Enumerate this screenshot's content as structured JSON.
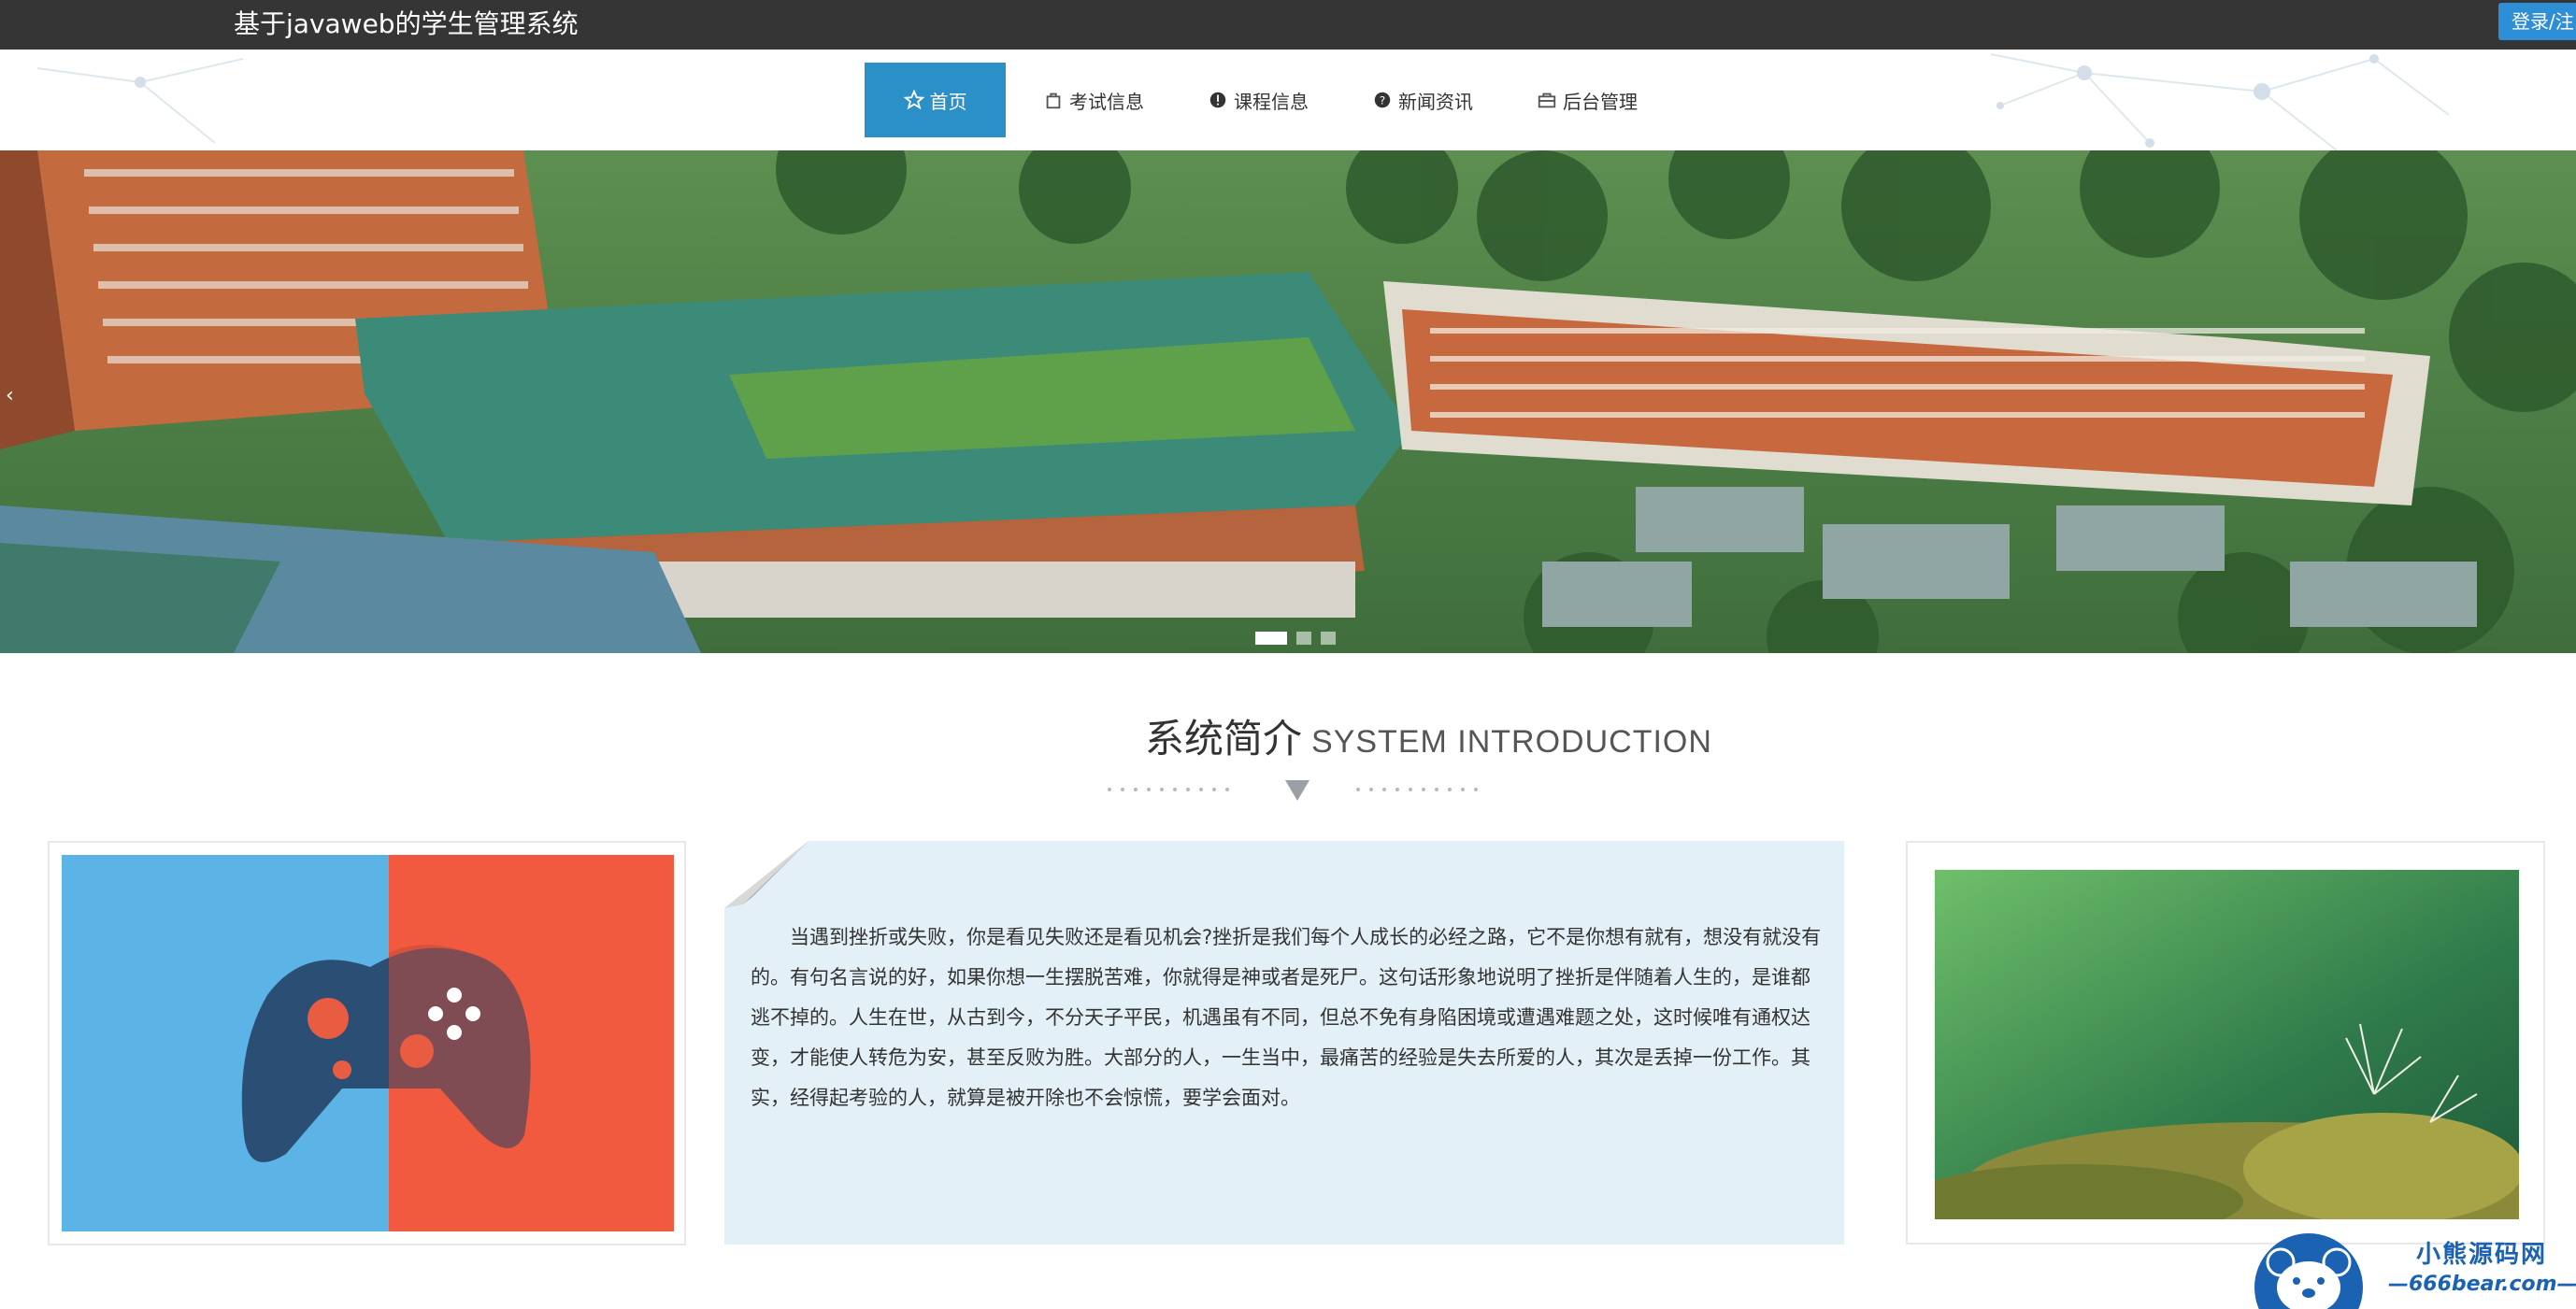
{
  "header": {
    "site_title": "基于javaweb的学生管理系统",
    "login_label": "登录/注"
  },
  "nav": {
    "items": [
      {
        "label": "首页",
        "icon": "star-icon",
        "active": true
      },
      {
        "label": "考试信息",
        "icon": "bag-icon",
        "active": false
      },
      {
        "label": "课程信息",
        "icon": "exclamation-circle-icon",
        "active": false
      },
      {
        "label": "新闻资讯",
        "icon": "question-circle-icon",
        "active": false
      },
      {
        "label": "后台管理",
        "icon": "briefcase-icon",
        "active": false
      }
    ]
  },
  "banner": {
    "slide_count": 3,
    "active_slide": 1
  },
  "intro": {
    "title_cn": "系统简介",
    "title_en": "SYSTEM INTRODUCTION",
    "text": "当遇到挫折或失败，你是看见失败还是看见机会?挫折是我们每个人成长的必经之路，它不是你想有就有，想没有就没有的。有句名言说的好，如果你想一生摆脱苦难，你就得是神或者是死尸。这句话形象地说明了挫折是伴随着人生的，是谁都逃不掉的。人生在世，从古到今，不分天子平民，机遇虽有不同，但总不免有身陷困境或遭遇难题之处，这时候唯有通权达变，才能使人转危为安，甚至反败为胜。大部分的人，一生当中，最痛苦的经验是失去所爱的人，其次是丢掉一份工作。其实，经得起考验的人，就算是被开除也不会惊慌，要学会面对。"
  },
  "watermark": {
    "name": "小熊源码网",
    "url": "—666bear.com—"
  },
  "colors": {
    "topbar": "#353535",
    "accent": "#2b90c8",
    "intro_bg": "#e3f0f7",
    "watermark": "#1b62b3"
  }
}
